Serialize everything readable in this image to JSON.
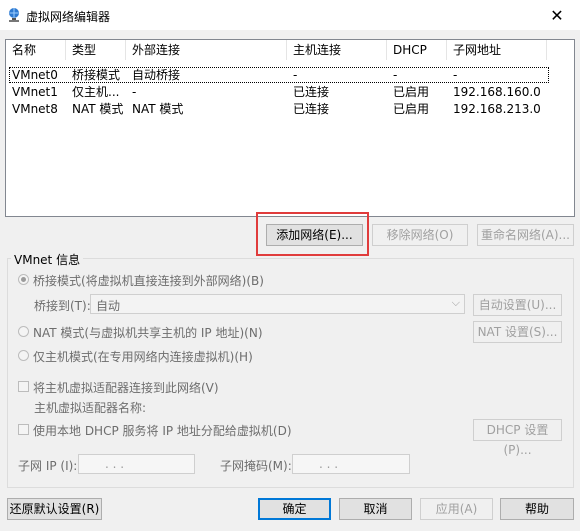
{
  "window": {
    "title": "虚拟网络编辑器",
    "close": "✕"
  },
  "table": {
    "headers": [
      "名称",
      "类型",
      "外部连接",
      "主机连接",
      "DHCP",
      "子网地址"
    ],
    "rows": [
      [
        "VMnet0",
        "桥接模式",
        "自动桥接",
        "-",
        "-",
        "-"
      ],
      [
        "VMnet1",
        "仅主机...",
        "-",
        "已连接",
        "已启用",
        "192.168.160.0"
      ],
      [
        "VMnet8",
        "NAT 模式",
        "NAT 模式",
        "已连接",
        "已启用",
        "192.168.213.0"
      ]
    ]
  },
  "list_buttons": {
    "add": "添加网络(E)...",
    "remove": "移除网络(O)",
    "rename": "重命名网络(A)..."
  },
  "vmnet_info": {
    "legend": "VMnet 信息",
    "bridged_label": "桥接模式(将虚拟机直接连接到外部网络)(B)",
    "bridge_to_label": "桥接到(T):",
    "bridge_to_value": "自动",
    "auto_settings": "自动设置(U)...",
    "nat_label": "NAT 模式(与虚拟机共享主机的 IP 地址)(N)",
    "nat_settings": "NAT 设置(S)...",
    "hostonly_label": "仅主机模式(在专用网络内连接虚拟机)(H)",
    "host_adapter_label": "将主机虚拟适配器连接到此网络(V)",
    "host_adapter_name_label": "主机虚拟适配器名称:",
    "dhcp_label": "使用本地 DHCP 服务将 IP 地址分配给虚拟机(D)",
    "dhcp_settings": "DHCP 设置(P)...",
    "subnet_ip_label": "子网 IP (I):",
    "subnet_ip_value": ".   .   .",
    "subnet_mask_label": "子网掩码(M):",
    "subnet_mask_value": ".   .   ."
  },
  "footer": {
    "restore": "还原默认设置(R)",
    "ok": "确定",
    "cancel": "取消",
    "apply": "应用(A)",
    "help": "帮助"
  },
  "colors": {
    "highlight": "#e03c3c",
    "primary_border": "#0078d7"
  }
}
